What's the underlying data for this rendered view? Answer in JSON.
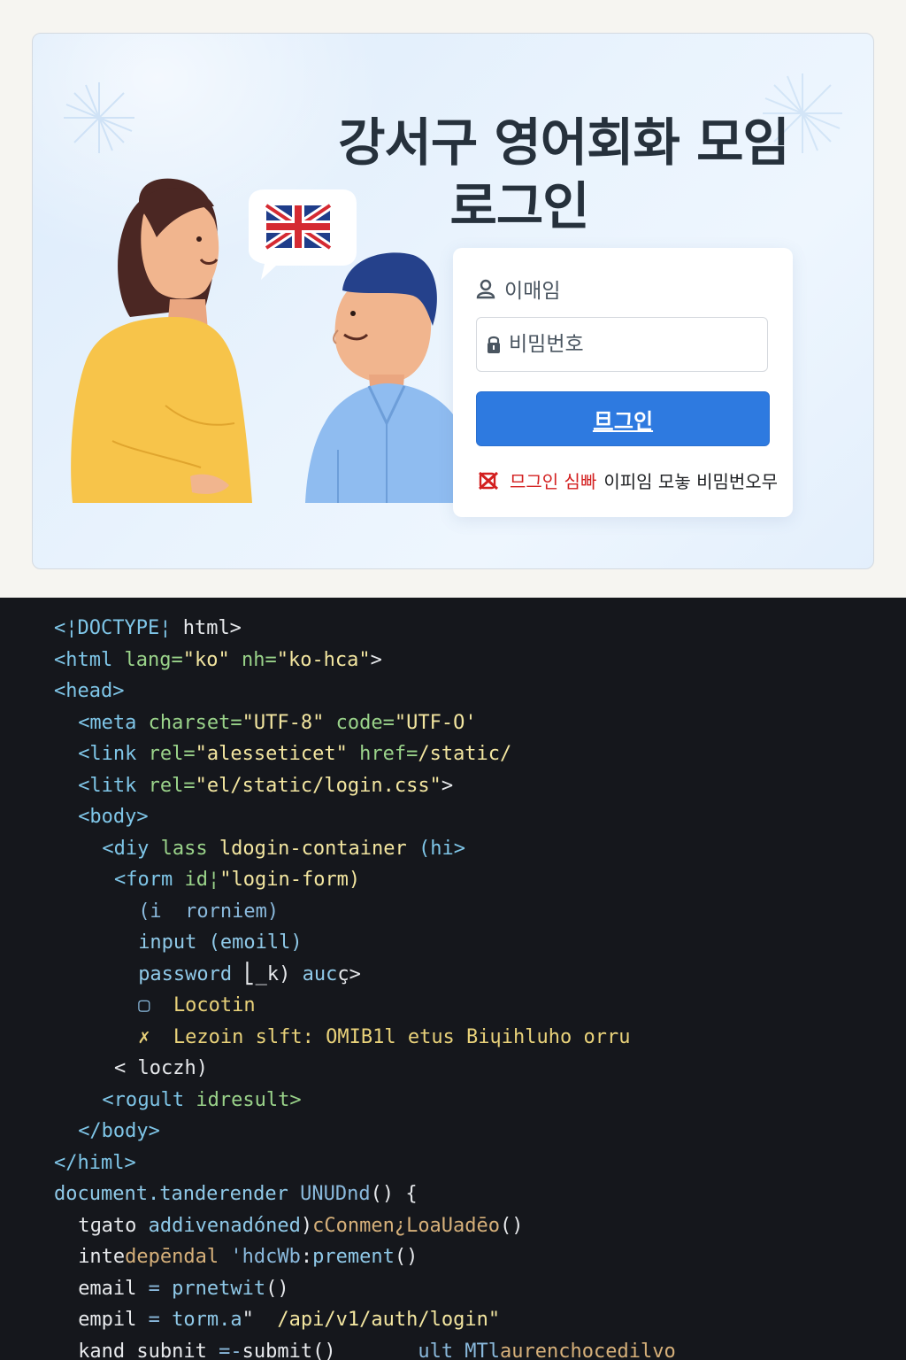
{
  "hero": {
    "title_line1": "강서구 영어회화 모임",
    "title_line2": "로그인"
  },
  "illustration": {
    "speech_bubble_flag": "uk-flag-icon"
  },
  "login_form": {
    "email_label": "이매임",
    "password_placeholder": "비밈번호",
    "submit_label": "旦그인",
    "error_prefix": "므그인 심빠",
    "error_message": "이피임 모놓 비밈번오무"
  },
  "code_editor": {
    "lines": [
      {
        "indent": 0,
        "parts": [
          {
            "c": "t-tag",
            "t": "<¦DOCTYPE¦ "
          },
          {
            "c": "t-white",
            "t": "html>"
          }
        ]
      },
      {
        "indent": 0,
        "parts": [
          {
            "c": "t-tag",
            "t": "<html "
          },
          {
            "c": "t-attr",
            "t": "lang="
          },
          {
            "c": "t-str",
            "t": "\"ko\" "
          },
          {
            "c": "t-attr",
            "t": "nh="
          },
          {
            "c": "t-str",
            "t": "\"ko-hca\""
          },
          {
            "c": "t-white",
            "t": ">"
          }
        ]
      },
      {
        "indent": 0,
        "parts": [
          {
            "c": "t-tag",
            "t": "<head>"
          }
        ]
      },
      {
        "indent": 2,
        "parts": [
          {
            "c": "t-tag",
            "t": "<meta "
          },
          {
            "c": "t-attr",
            "t": "charset="
          },
          {
            "c": "t-str",
            "t": "\"UTF-8\" "
          },
          {
            "c": "t-attr",
            "t": "code="
          },
          {
            "c": "t-str",
            "t": "\"UTF-O'"
          }
        ]
      },
      {
        "indent": 2,
        "parts": [
          {
            "c": "t-tag",
            "t": "<link "
          },
          {
            "c": "t-attr",
            "t": "rel="
          },
          {
            "c": "t-str",
            "t": "\"alesseticet\" "
          },
          {
            "c": "t-attr",
            "t": "href="
          },
          {
            "c": "t-str",
            "t": "/static/"
          }
        ]
      },
      {
        "indent": 2,
        "parts": [
          {
            "c": "t-tag",
            "t": "<litk "
          },
          {
            "c": "t-attr",
            "t": "rel="
          },
          {
            "c": "t-str",
            "t": "\"el/static/login.css\""
          },
          {
            "c": "t-white",
            "t": ">"
          }
        ]
      },
      {
        "indent": 2,
        "parts": [
          {
            "c": "t-tag",
            "t": "<body>"
          }
        ]
      },
      {
        "indent": 4,
        "parts": [
          {
            "c": "t-tag",
            "t": "<diy "
          },
          {
            "c": "t-attr",
            "t": "lass "
          },
          {
            "c": "t-str",
            "t": "ldogin-container "
          },
          {
            "c": "t-tag",
            "t": "(hi>"
          }
        ]
      },
      {
        "indent": 5,
        "parts": [
          {
            "c": "t-tag",
            "t": "<form "
          },
          {
            "c": "t-attr",
            "t": "id¦"
          },
          {
            "c": "t-str",
            "t": "\"login-form)"
          }
        ]
      },
      {
        "indent": 7,
        "parts": [
          {
            "c": "t-blue",
            "t": "(i  rorniem)"
          }
        ]
      },
      {
        "indent": 7,
        "parts": [
          {
            "c": "t-fn",
            "t": "input (emoill)"
          }
        ]
      },
      {
        "indent": 7,
        "parts": [
          {
            "c": "t-fn",
            "t": "password "
          },
          {
            "c": "t-white",
            "t": "⎣_k) "
          },
          {
            "c": "t-fn",
            "t": "auc"
          },
          {
            "c": "t-white",
            "t": "ç>"
          }
        ]
      },
      {
        "indent": 7,
        "parts": [
          {
            "c": "t-blue",
            "t": "▢  "
          },
          {
            "c": "t-yel",
            "t": "Locotin"
          }
        ]
      },
      {
        "indent": 7,
        "parts": [
          {
            "c": "t-yel",
            "t": "✗  Lezoin slft: OMIB1l etus Biɥihluho orru"
          }
        ]
      },
      {
        "indent": 5,
        "parts": [
          {
            "c": "t-white",
            "t": "< loczh)"
          }
        ]
      },
      {
        "indent": 4,
        "parts": [
          {
            "c": "t-tag",
            "t": "<roɡult "
          },
          {
            "c": "t-attr",
            "t": "idresult>"
          }
        ]
      },
      {
        "indent": 2,
        "parts": [
          {
            "c": "t-tag",
            "t": "</body>"
          }
        ]
      },
      {
        "indent": 0,
        "parts": [
          {
            "c": "t-tag",
            "t": "</himl>"
          }
        ]
      },
      {
        "indent": 0,
        "parts": [
          {
            "c": "t-fn",
            "t": "document.tanderender "
          },
          {
            "c": "t-blue",
            "t": "UNUDnd"
          },
          {
            "c": "t-white",
            "t": "() {"
          }
        ]
      },
      {
        "indent": 2,
        "parts": [
          {
            "c": "t-white",
            "t": "tɡato "
          },
          {
            "c": "t-fn",
            "t": "addivenadóned"
          },
          {
            "c": "t-white",
            "t": ")"
          },
          {
            "c": "t-key",
            "t": "cConmen¿LoaUadēo"
          },
          {
            "c": "t-white",
            "t": "()"
          }
        ]
      },
      {
        "indent": 2,
        "parts": [
          {
            "c": "t-white",
            "t": "inte"
          },
          {
            "c": "t-key",
            "t": "depēndal "
          },
          {
            "c": "t-blue",
            "t": "'hdcWb"
          },
          {
            "c": "t-white",
            "t": ":"
          },
          {
            "c": "t-fn",
            "t": "prement"
          },
          {
            "c": "t-white",
            "t": "()"
          }
        ]
      },
      {
        "indent": 2,
        "parts": [
          {
            "c": "t-white",
            "t": "email "
          },
          {
            "c": "t-blue",
            "t": "= "
          },
          {
            "c": "t-fn",
            "t": "prnetwit"
          },
          {
            "c": "t-white",
            "t": "()"
          }
        ]
      },
      {
        "indent": 2,
        "parts": [
          {
            "c": "t-white",
            "t": "empil "
          },
          {
            "c": "t-blue",
            "t": "= "
          },
          {
            "c": "t-fn",
            "t": "torm.a"
          },
          {
            "c": "t-white",
            "t": "\"  "
          },
          {
            "c": "t-str",
            "t": "/api/v1/auth/login\""
          }
        ]
      },
      {
        "indent": 2,
        "parts": [
          {
            "c": "t-white",
            "t": "kand subnit "
          },
          {
            "c": "t-blue",
            "t": "=-"
          },
          {
            "c": "t-white",
            "t": "submit()       "
          },
          {
            "c": "t-blue",
            "t": "ult MTl"
          },
          {
            "c": "t-key",
            "t": "aurenchocedilvo"
          }
        ]
      }
    ]
  },
  "colors": {
    "button_blue": "#2e7ae0",
    "error_red": "#d32020",
    "code_bg": "#15171c"
  }
}
